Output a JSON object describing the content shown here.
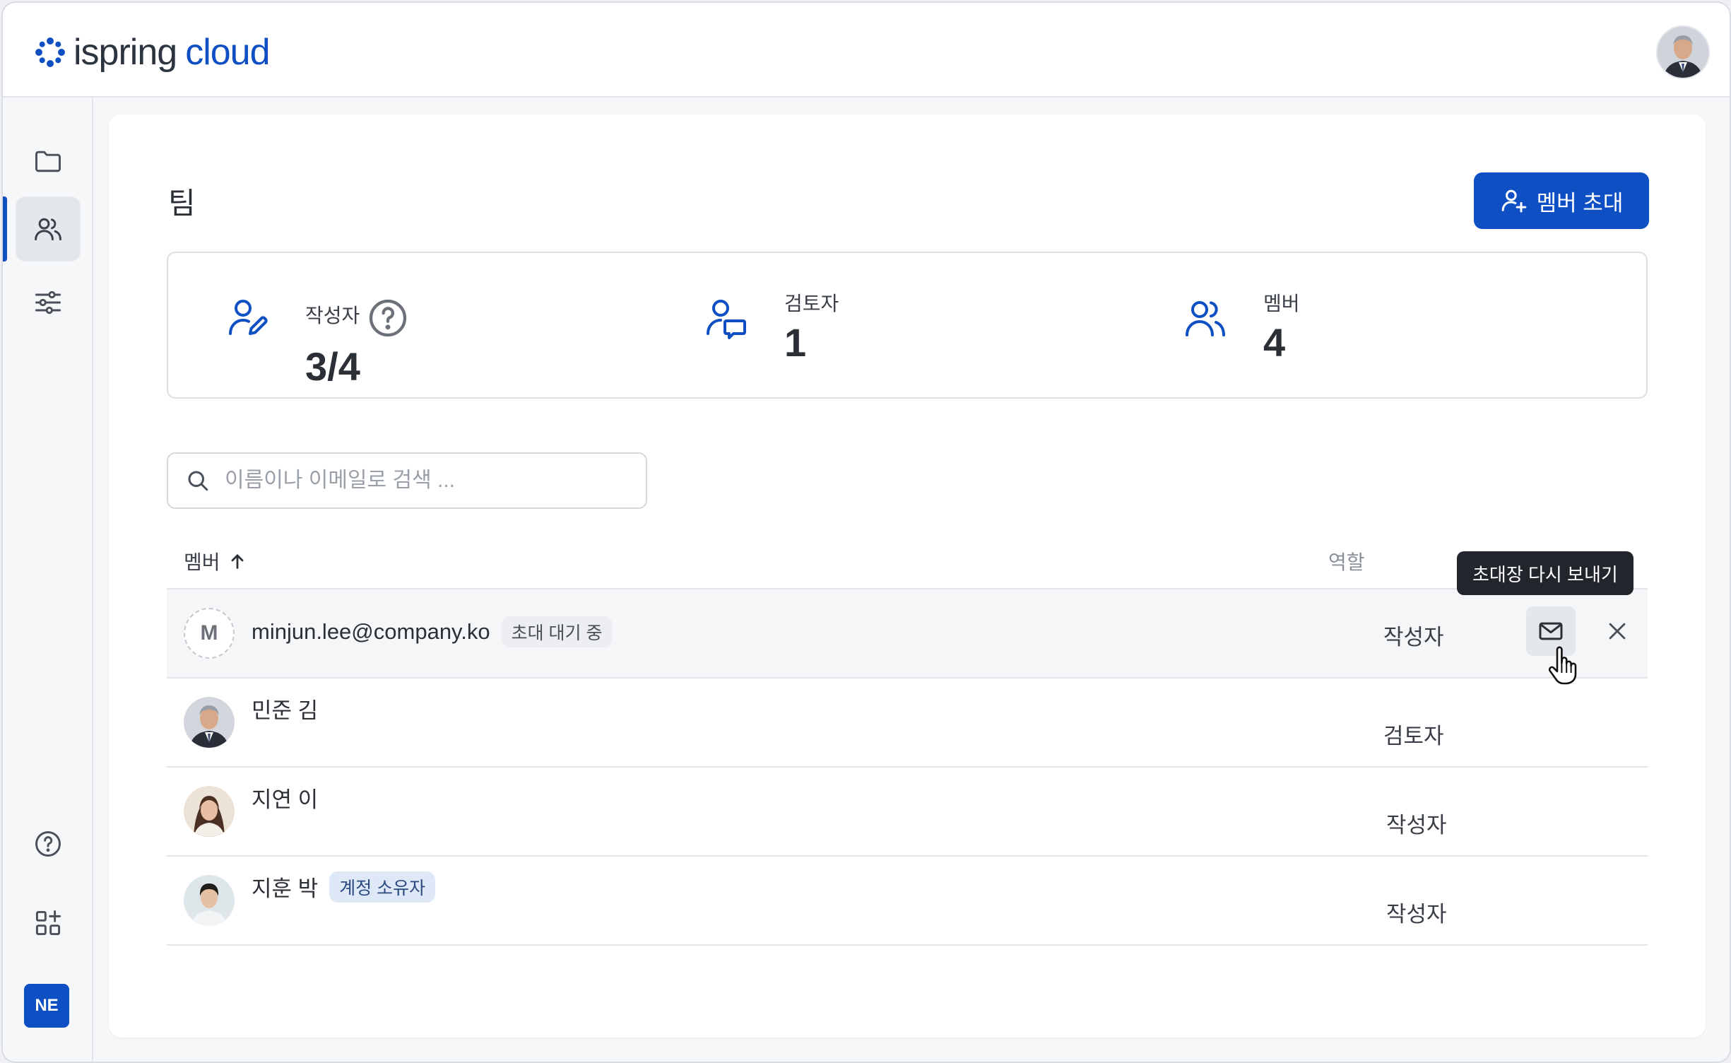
{
  "app": {
    "brand_primary": "ispring",
    "brand_secondary": "cloud",
    "accent_color": "#0f4fc4"
  },
  "sidebar": {
    "items": [
      {
        "icon": "folder-icon",
        "active": false
      },
      {
        "icon": "users-icon",
        "active": true
      },
      {
        "icon": "sliders-icon",
        "active": false
      }
    ],
    "bottom": [
      {
        "icon": "help-circle-icon"
      },
      {
        "icon": "apps-add-icon"
      }
    ],
    "user_initials": "NE"
  },
  "page": {
    "title": "팀",
    "invite_button": "멤버 초대"
  },
  "stats": [
    {
      "label": "작성자",
      "value": "3/4",
      "icon": "author-edit-icon",
      "has_help": true
    },
    {
      "label": "검토자",
      "value": "1",
      "icon": "reviewer-chat-icon",
      "has_help": false
    },
    {
      "label": "멤버",
      "value": "4",
      "icon": "members-icon",
      "has_help": false
    }
  ],
  "search": {
    "placeholder": "이름이나 이메일로 검색 ...",
    "value": ""
  },
  "table": {
    "columns": {
      "member": "멤버",
      "role": "역할"
    },
    "sort": "ascending",
    "rows": [
      {
        "name": "minjun.lee@company.ko",
        "badge": "초대 대기 중",
        "role": "작성자",
        "initial": "M",
        "pending": true
      },
      {
        "name": "민준 김",
        "badge": "",
        "role": "검토자",
        "pending": false
      },
      {
        "name": "지연 이",
        "badge": "",
        "role": "작성자",
        "pending": false
      },
      {
        "name": "지훈 박",
        "badge": "계정 소유자",
        "role": "작성자",
        "pending": false
      }
    ]
  },
  "tooltip": {
    "text": "초대장 다시 보내기"
  }
}
